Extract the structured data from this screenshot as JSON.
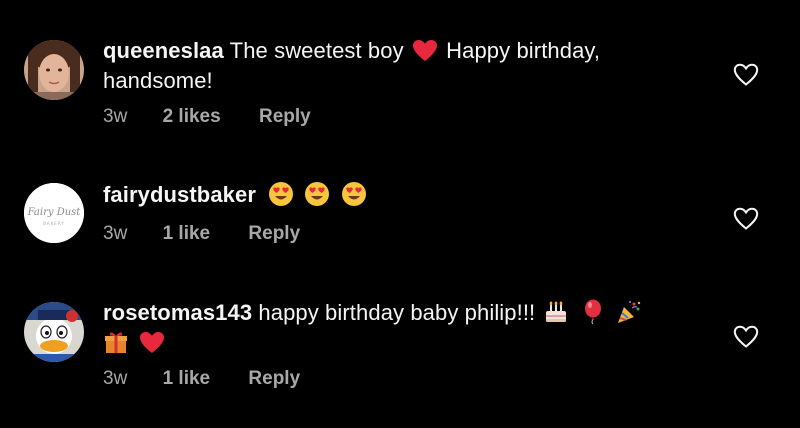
{
  "comments": [
    {
      "username": "queeneslaa",
      "text_part1": "The sweetest boy",
      "text_part2": "Happy birthday,",
      "text_line2": "handsome!",
      "time": "3w",
      "likes": "2 likes",
      "reply": "Reply",
      "inline_emojis": [
        "red-heart-emoji"
      ]
    },
    {
      "username": "fairydustbaker",
      "text_part1": "",
      "avatar_logo_text": "Fairy Dust",
      "avatar_logo_subtext": "BAKERY",
      "time": "3w",
      "likes": "1 like",
      "reply": "Reply",
      "inline_emojis": [
        "heart-eyes-emoji",
        "heart-eyes-emoji",
        "heart-eyes-emoji"
      ]
    },
    {
      "username": "rosetomas143",
      "text_part1": "happy birthday baby philip!!!",
      "time": "3w",
      "likes": "1 like",
      "reply": "Reply",
      "inline_emojis": [
        "birthday-cake-emoji",
        "balloon-emoji",
        "party-popper-emoji",
        "gift-emoji",
        "red-heart-emoji"
      ]
    }
  ],
  "colors": {
    "background": "#000000",
    "primary_text": "#f5f5f5",
    "secondary_text": "#a8a8a8",
    "heart_red": "#ed4956"
  }
}
